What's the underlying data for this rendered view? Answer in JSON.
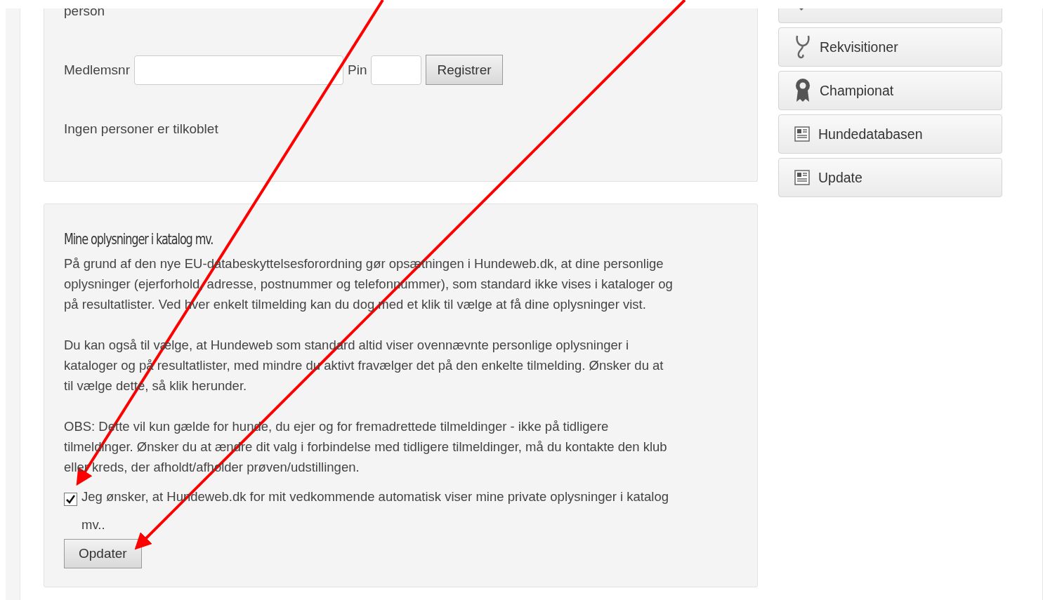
{
  "register_panel": {
    "cut_text": "person",
    "member_label": "Medlemsnr",
    "pin_label": "Pin",
    "register_button": "Registrer",
    "status": "Ingen personer er tilkoblet"
  },
  "catalog_panel": {
    "heading": "Mine oplysninger i katalog mv.",
    "paragraphs": [
      "På grund af den nye EU-databeskyttelsesforordning gør opsætningen i Hundeweb.dk, at dine personlige\noplysninger (ejerforhold, adresse, postnummer og telefonnummer), som standard ikke vises i kataloger og\npå resultatlister. Ved hver enkelt tilmelding kan du dog med et klik til vælge at få dine oplysninger vist.",
      "Du kan også til vælge, at Hundeweb som standard altid viser ovennævnte personlige oplysninger i\nkataloger og på resultatlister, med mindre du aktivt fravælger det på den enkelte tilmelding. Ønsker du at\ntil vælge dette, så klik herunder.",
      "OBS: Dette vil kun gælde for hunde, du ejer og for fremadrettede tilmeldinger - ikke på tidligere\ntilmeldinger. Ønsker du at ændre dit valg i forbindelse med tidligere tilmeldinger, må du kontakte den klub\neller kreds, der afholdt/afholder prøven/udstillingen."
    ],
    "checkbox": {
      "label": "Jeg ønsker, at Hundeweb.dk for mit vedkommende automatisk viser mine private oplysninger i katalog\nmv..",
      "checked": true
    },
    "update_button": "Opdater"
  },
  "sidebar": {
    "items": [
      {
        "kind": "cut"
      },
      {
        "kind": "stethoscope",
        "label": "Rekvisitioner"
      },
      {
        "kind": "award",
        "label": "Championat"
      },
      {
        "kind": "document",
        "label": "Hundedatabasen"
      },
      {
        "kind": "document",
        "label": "Update"
      }
    ]
  }
}
